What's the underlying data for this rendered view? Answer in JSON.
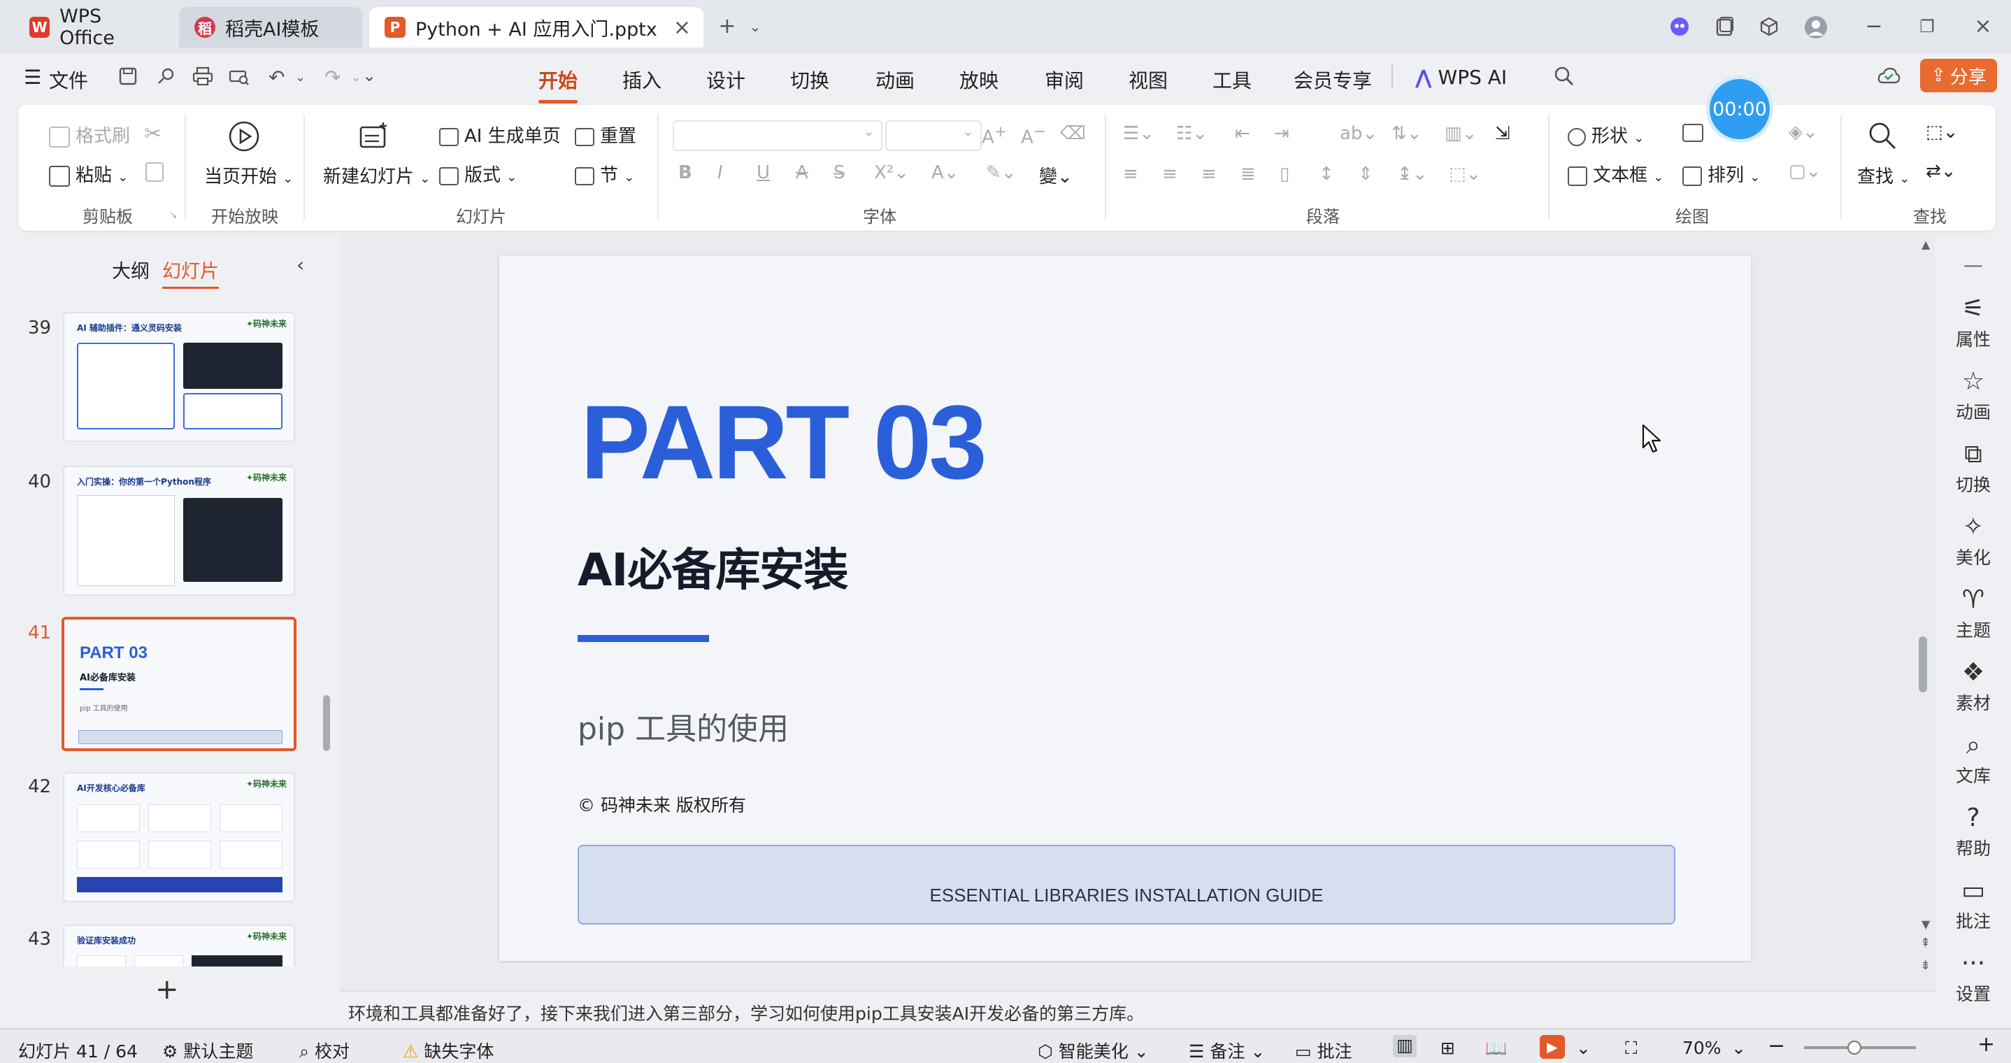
{
  "tabs": [
    {
      "label": "WPS Office"
    },
    {
      "label": "稻壳AI模板"
    },
    {
      "label": "Python + AI 应用入门.pptx"
    }
  ],
  "menu": {
    "file": "文件",
    "items": [
      "开始",
      "插入",
      "设计",
      "切换",
      "动画",
      "放映",
      "审阅",
      "视图",
      "工具",
      "会员专享"
    ],
    "wps_ai": "WPS AI",
    "share": "分享"
  },
  "timer": "00:00",
  "ribbon": {
    "format_painter": "格式刷",
    "paste": "粘贴",
    "clipboard": "剪贴板",
    "start_current": "当页开始",
    "start_show": "开始放映",
    "new_slide": "新建幻灯片",
    "ai_generate": "AI 生成单页",
    "layout": "版式",
    "reset": "重置",
    "section": "节",
    "slides": "幻灯片",
    "font": "字体",
    "paragraph": "段落",
    "shape": "形状",
    "textbox": "文本框",
    "arrange": "排列",
    "drawing": "绘图",
    "find": "查找",
    "find_group": "查找"
  },
  "panel": {
    "outline_tab": "大纲",
    "slides_tab": "幻灯片",
    "thumbnails": [
      {
        "num": "39",
        "title": "AI 辅助插件：通义灵码安装"
      },
      {
        "num": "40",
        "title": "入门实操：你的第一个Python程序"
      },
      {
        "num": "41",
        "title": "PART 03",
        "subtitle": "AI必备库安装",
        "sub2": "pip 工具的使用"
      },
      {
        "num": "42",
        "title": "AI开发核心必备库"
      },
      {
        "num": "43",
        "title": "验证库安装成功"
      }
    ]
  },
  "slide": {
    "part": "PART 03",
    "title": "AI必备库安装",
    "subtitle": "pip 工具的使用",
    "copyright": "© 码神未来 版权所有",
    "banner": "ESSENTIAL LIBRARIES INSTALLATION GUIDE"
  },
  "notes": "环境和工具都准备好了，接下来我们进入第三部分，学习如何使用pip工具安装AI开发必备的第三方库。",
  "sidebar": [
    "属性",
    "动画",
    "切换",
    "美化",
    "主题",
    "素材",
    "文库",
    "帮助",
    "批注",
    "设置"
  ],
  "status": {
    "slide_count": "幻灯片 41 / 64",
    "theme": "默认主题",
    "proof": "校对",
    "missing_font": "缺失字体",
    "smart_beautify": "智能美化",
    "notes": "备注",
    "comments": "批注",
    "zoom": "70%"
  },
  "colors": {
    "accent": "#e2592a",
    "slide_blue": "#2b5fd9",
    "timer": "#2f9ef2"
  }
}
